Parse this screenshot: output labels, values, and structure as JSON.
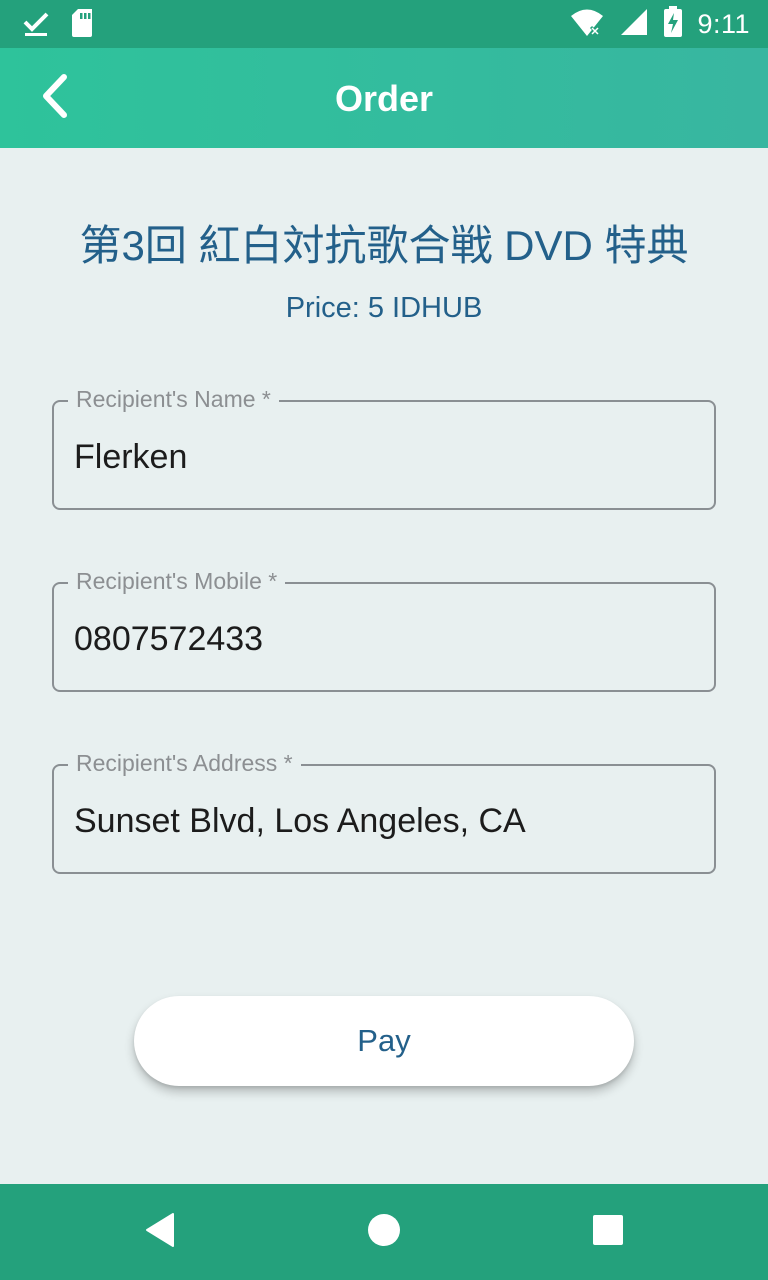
{
  "status_bar": {
    "time": "9:11",
    "icons": [
      "download-done-icon",
      "sd-card-icon",
      "wifi-off-icon",
      "signal-icon",
      "battery-charging-icon"
    ]
  },
  "app_bar": {
    "title": "Order",
    "back_icon": "chevron-left-icon"
  },
  "product": {
    "title": "第3回 紅白対抗歌合戦 DVD 特典",
    "price": "Price: 5 IDHUB"
  },
  "form": {
    "name": {
      "label": "Recipient's Name *",
      "value": "Flerken"
    },
    "mobile": {
      "label": "Recipient's Mobile *",
      "value": "0807572433"
    },
    "address": {
      "label": "Recipient's Address *",
      "value": "Sunset Blvd, Los Angeles, CA"
    }
  },
  "pay_button": {
    "label": "Pay"
  },
  "colors": {
    "status_bar": "#24a17c",
    "app_bar_start": "#2ec39b",
    "app_bar_end": "#38b6a0",
    "background": "#e8f0f0",
    "accent_text": "#23608a"
  },
  "nav_bar": {
    "icons": [
      "back-triangle-icon",
      "home-circle-icon",
      "recents-square-icon"
    ]
  }
}
